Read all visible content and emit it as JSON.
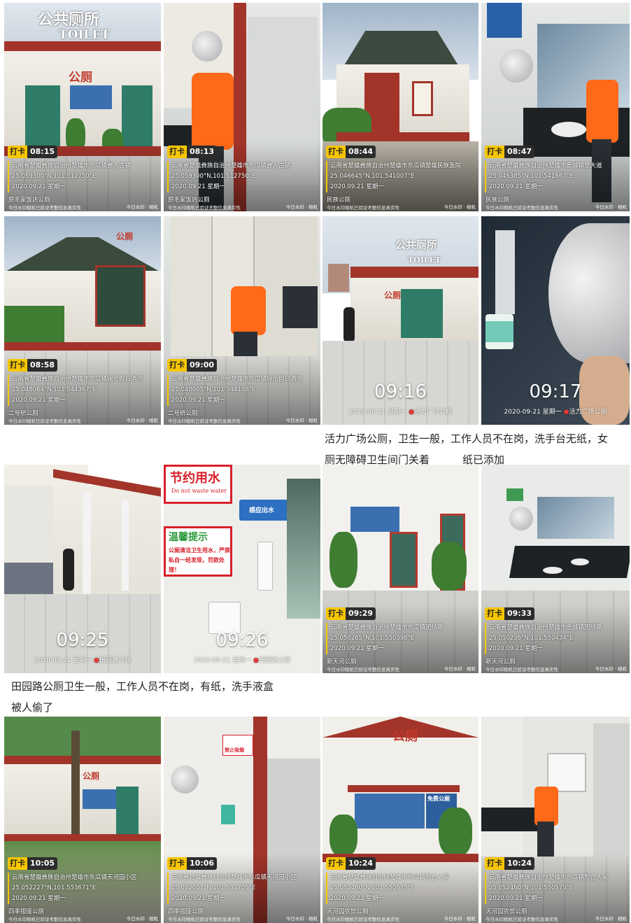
{
  "row1": [
    {
      "time": "08:15",
      "tag": "打卡",
      "addr": "云南省楚雄彝族自治州楚雄市东瓜镇彝人古镇",
      "coord": "25.059300°N,101.512750°E",
      "date": "2020.09.21 星期一",
      "place": "原毛家饭店公厕",
      "verify": "今日水印相机已验证考勤信息真实性",
      "wm": "今日水印 · 相机"
    },
    {
      "time": "08:13",
      "tag": "打卡",
      "addr": "云南省楚雄彝族自治州楚雄市东瓜镇彝人古镇",
      "coord": "25.059300°N,101.512750°E",
      "date": "2020.09.21 星期一",
      "place": "原毛家饭店公厕",
      "verify": "今日水印相机已验证考勤信息真实性",
      "wm": "今日水印 · 相机"
    },
    {
      "time": "08:44",
      "tag": "打卡",
      "addr": "云南省楚雄彝族自治州楚雄市东瓜镇楚雄民族医院",
      "coord": "25.046645°N,101.541007°E",
      "date": "2020.09.21 星期一",
      "place": "民族公厕",
      "verify": "今日水印相机已验证考勤信息真实性",
      "wm": "今日水印 · 相机"
    },
    {
      "time": "08:47",
      "tag": "打卡",
      "addr": "云南省楚雄彝族自治州楚雄市鹿城镇楚大道",
      "coord": "25.046385°N,101.541867°E",
      "date": "2020.09.21 星期一",
      "place": "民族公厕",
      "verify": "今日水印相机已验证考勤信息真实性",
      "wm": "今日水印 · 相机"
    }
  ],
  "row2": [
    {
      "time": "08:58",
      "tag": "打卡",
      "addr": "云南省楚雄彝族自治州楚雄市东瓜镇锦伦假日酒店",
      "coord": "25.048064°N,101.544367°E",
      "date": "2020.09.21 星期一",
      "place": "二号桥公厕",
      "verify": "今日水印相机已验证考勤信息真实性",
      "wm": "今日水印 · 相机"
    },
    {
      "time": "09:00",
      "tag": "打卡",
      "addr": "云南省楚雄彝族自治州楚雄市东瓜镇锦伦假日酒店",
      "coord": "25.048005°N,101.544138°E",
      "date": "2020.09.21 星期一",
      "place": "二号桥公厕",
      "verify": "今日水印相机已验证考勤信息真实性",
      "wm": "今日水印 · 相机"
    }
  ],
  "row2_big": [
    {
      "time": "09:16",
      "sub": "2020-09-21 星期一",
      "loc": "活力广场公厕"
    },
    {
      "time": "09:17",
      "sub": "2020-09-21 星期一",
      "loc": "活力广场公厕"
    }
  ],
  "caption1": {
    "line1": "活力广场公厕，卫生一般，工作人员不在岗，洗手台无纸，女",
    "line2a": "厕无障碍卫生间门关着",
    "line2b": "纸已添加"
  },
  "row3_big": [
    {
      "time": "09:25",
      "sub": "2020-09-21 星期一",
      "loc": "田园路公厕"
    },
    {
      "time": "09:26",
      "sub": "2020-09-21 星期一",
      "loc": "田园路公厕"
    }
  ],
  "row3": [
    {
      "time": "09:29",
      "tag": "打卡",
      "addr": "云南省楚雄彝族自治州楚雄市东瓜镇团结路",
      "coord": "25.050265°N,101.550398°E",
      "date": "2020.09.21 星期一",
      "place": "新天河公厕",
      "verify": "今日水印相机已验证考勤信息真实性",
      "wm": "今日水印 · 相机"
    },
    {
      "time": "09:33",
      "tag": "打卡",
      "addr": "云南省楚雄彝族自治州楚雄市鹿城镇团结路",
      "coord": "25.050236°N,101.550434°E",
      "date": "2020.09.21 星期一",
      "place": "新天河公厕",
      "verify": "今日水印相机已验证考勤信息真实性",
      "wm": "今日水印 · 相机"
    }
  ],
  "caption2": {
    "line1": "田园路公厕卫生一般，工作人员不在岗，有纸，洗手液盒",
    "line2": "被人偷了"
  },
  "row4": [
    {
      "time": "10:05",
      "tag": "打卡",
      "addr": "云南省楚雄彝族自治州楚雄市东瓜镇天河园小区",
      "coord": "25.052227°N,101.553671°E",
      "date": "2020.09.21 星期一",
      "place": "四季银座公厕",
      "verify": "今日水印相机已验证考勤信息真实性",
      "wm": "今日水印 · 相机"
    },
    {
      "time": "10:06",
      "tag": "打卡",
      "addr": "云南省楚雄彝族自治州楚雄市东瓜镇天河园小区",
      "coord": "25.052057°N,101.553705°E",
      "date": "2020.09.21 星期一",
      "place": "四季银座公厕",
      "verify": "今日水印相机已验证考勤信息真实性",
      "wm": "今日水印 · 相机"
    },
    {
      "time": "10:24",
      "tag": "打卡",
      "addr": "云南省楚雄彝族自治州楚雄市东瓜镇熙合人家",
      "coord": "25.052460°N,101.550575°E",
      "date": "2020.09.21 星期一",
      "place": "天河园农贸公厕",
      "verify": "今日水印相机已验证考勤信息真实性",
      "wm": "今日水印 · 相机"
    },
    {
      "time": "10:24",
      "tag": "打卡",
      "addr": "云南省楚雄彝族自治州楚雄市东瓜镇熙合人家",
      "coord": "25.052460°N,101.550575°E",
      "date": "2020.09.21 星期一",
      "place": "天河园农贸公厕",
      "verify": "今日水印相机已验证考勤信息真实性",
      "wm": "今日水印 · 相机"
    }
  ],
  "signs": {
    "toilet_cn": "公共厕所",
    "toilet_en": "TOILET",
    "gongce": "公厕",
    "save_water": "节约用水",
    "save_water_en": "Do not waste water",
    "warm_tip": "温馨提示",
    "warm_body": "公厕清洁卫生用水，严禁私自一经发现，罚款处理！",
    "sensor": "感应出水",
    "no_smoking": "禁止吸烟",
    "free_use": "免费公厕"
  }
}
